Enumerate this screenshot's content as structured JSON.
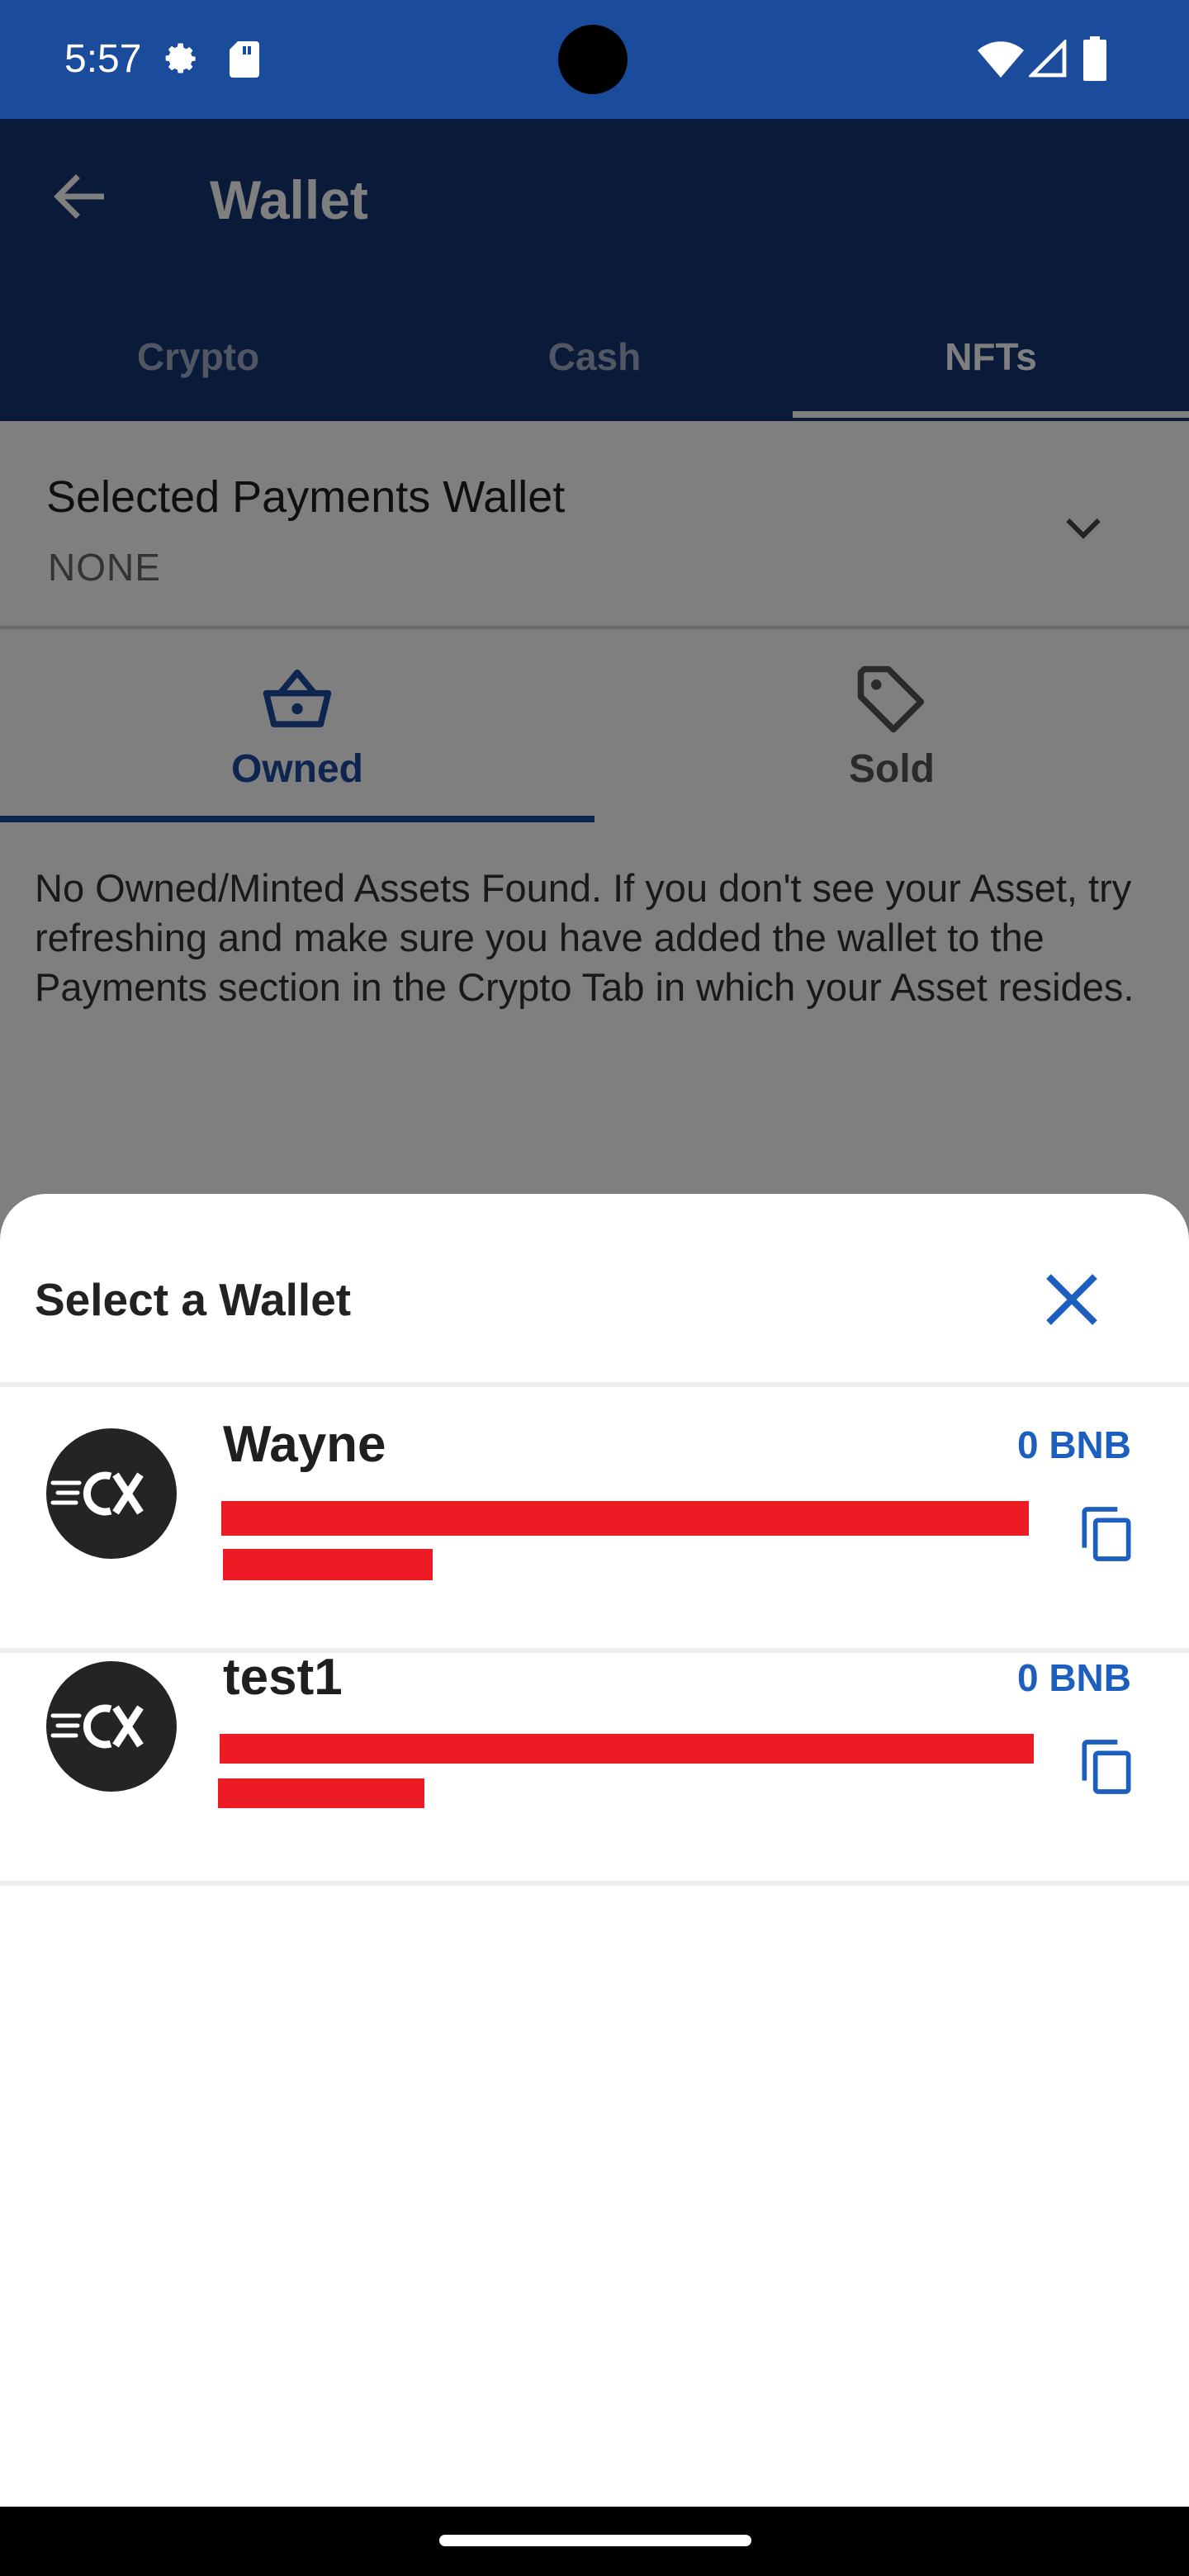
{
  "status_bar": {
    "time": "5:57",
    "icons": [
      "settings-gear-icon",
      "sd-card-icon",
      "wifi-icon",
      "cell-signal-icon",
      "battery-icon"
    ]
  },
  "app_bar": {
    "title": "Wallet",
    "tabs": [
      {
        "label": "Crypto",
        "active": false
      },
      {
        "label": "Cash",
        "active": false
      },
      {
        "label": "NFTs",
        "active": true
      }
    ]
  },
  "payments_wallet": {
    "title": "Selected Payments Wallet",
    "value": "NONE"
  },
  "sub_tabs": [
    {
      "label": "Owned",
      "icon": "basket-icon",
      "active": true
    },
    {
      "label": "Sold",
      "icon": "tag-icon",
      "active": false
    }
  ],
  "empty_message": "No Owned/Minted Assets Found. If you don't see your Asset, try refreshing and make sure you have added the wallet to the Payments section in the Crypto Tab in which your Asset resides.",
  "sheet": {
    "title": "Select a Wallet",
    "wallets": [
      {
        "name": "Wayne",
        "balance": "0 BNB",
        "avatar": "logo-icon"
      },
      {
        "name": "test1",
        "balance": "0 BNB",
        "avatar": "logo-icon"
      }
    ]
  },
  "colors": {
    "status_bar": "#1b4b9b",
    "app_bar": "#143573",
    "accent": "#1c4aa0",
    "balance": "#1d5fbf",
    "redaction": "#ed1c24"
  }
}
